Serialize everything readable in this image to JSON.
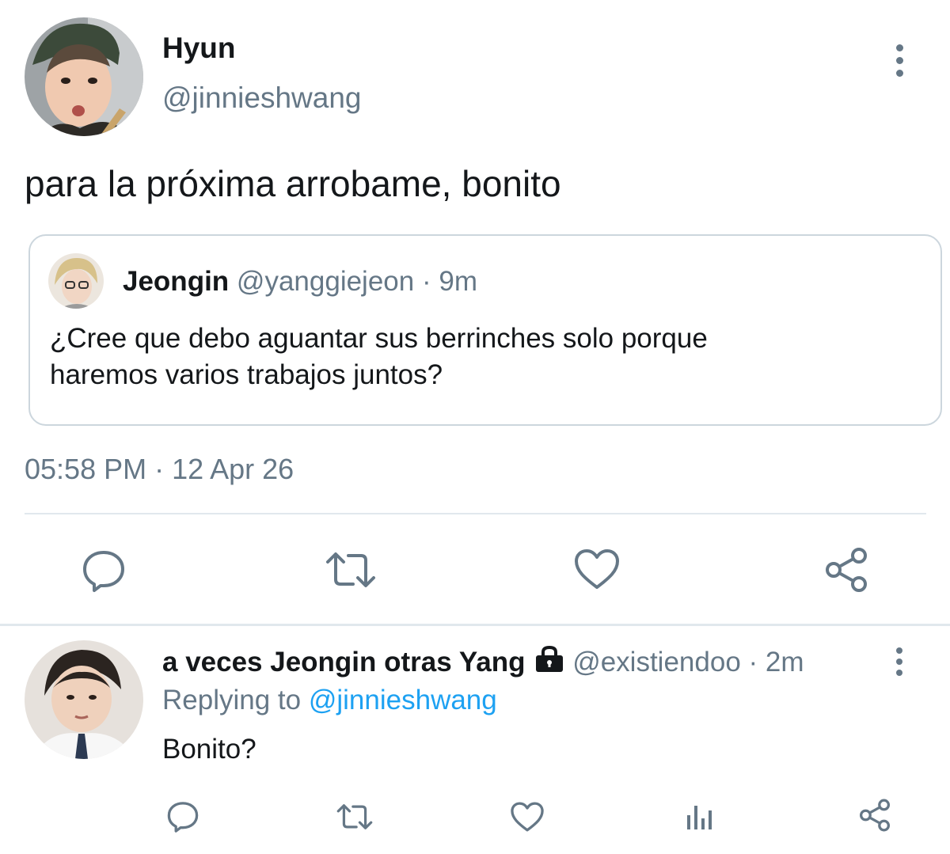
{
  "colors": {
    "text": "#14171a",
    "muted": "#657786",
    "accent": "#1da1f2",
    "divider": "#e1e8ed",
    "card_border": "#ccd6dd"
  },
  "main_tweet": {
    "display_name": "Hyun",
    "handle": "@jinnieshwang",
    "text": "para la próxima arrobame, bonito",
    "quote": {
      "display_name": "Jeongin",
      "handle": "@yanggiejeon",
      "time": "· 9m",
      "text_line1": "¿Cree que debo aguantar sus berrinches solo porque",
      "text_line2": "haremos varios trabajos juntos?"
    },
    "timestamp": "05:58 PM · 12 Apr 26",
    "actions": [
      "reply-icon",
      "retweet-icon",
      "like-icon",
      "share-icon"
    ]
  },
  "reply": {
    "display_name": "a veces Jeongin otras Yang",
    "handle": "@existiendoo",
    "time": "· 2m",
    "replying_prefix": "Replying to",
    "replying_handle": "@jinnieshwang",
    "text": "Bonito?",
    "actions": [
      "reply-icon",
      "retweet-icon",
      "like-icon",
      "analytics-icon",
      "share-icon"
    ]
  }
}
